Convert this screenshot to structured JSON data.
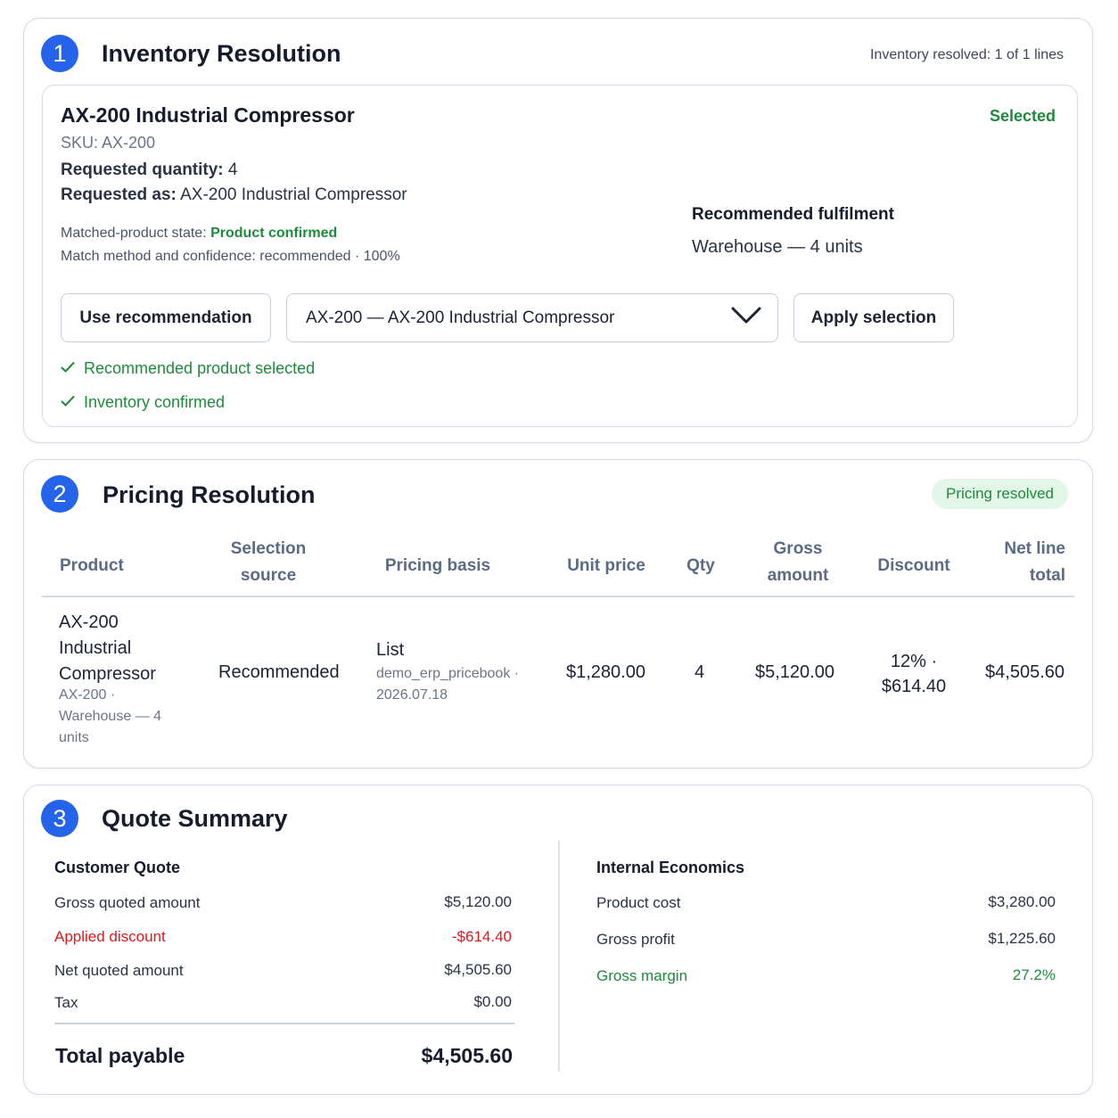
{
  "inventory": {
    "step": "1",
    "title": "Inventory Resolution",
    "status": "Inventory resolved: 1 of 1 lines",
    "product_name": "AX-200 Industrial Compressor",
    "selected_label": "Selected",
    "sku": "SKU: AX-200",
    "requested_quantity_label": "Requested quantity:",
    "requested_quantity_value": "4",
    "requested_as_label": "Requested as:",
    "requested_as_value": "AX-200 Industrial Compressor",
    "matched_state_label": "Matched-product state:",
    "matched_state_value": "Product confirmed",
    "match_method": "Match method and confidence: recommended · 100%",
    "fulfilment_title": "Recommended fulfilment",
    "fulfilment_value": "Warehouse — 4 units",
    "use_recommendation_label": "Use recommendation",
    "product_select_value": "AX-200 — AX-200 Industrial Compressor",
    "apply_selection_label": "Apply selection",
    "checks": [
      "Recommended product selected",
      "Inventory confirmed"
    ],
    "check_icon": "checkmark-icon"
  },
  "pricing": {
    "step": "2",
    "title": "Pricing Resolution",
    "status_pill": "Pricing resolved",
    "headers": {
      "product": "Product",
      "selection_source": "Selection\nsource",
      "pricing_basis": "Pricing basis",
      "unit_price": "Unit price",
      "qty": "Qty",
      "gross_amount": "Gross\namount",
      "discount": "Discount",
      "net_line_total": "Net line\ntotal"
    },
    "row": {
      "product_name": "AX-200\nIndustrial\nCompressor",
      "product_sub": "AX-200 ·\nWarehouse — 4\nunits",
      "selection_source": "Recommended",
      "pricing_basis": "List",
      "pricing_basis_sub": "demo_erp_pricebook ·\n2026.07.18",
      "unit_price": "$1,280.00",
      "qty": "4",
      "gross_amount": "$5,120.00",
      "discount": "12% ·\n$614.40",
      "net_line_total": "$4,505.60"
    }
  },
  "summary": {
    "step": "3",
    "title": "Quote Summary",
    "customer": {
      "heading": "Customer Quote",
      "gross_label": "Gross quoted amount",
      "gross_value": "$5,120.00",
      "discount_label": "Applied discount",
      "discount_value": "-$614.40",
      "net_label": "Net quoted amount",
      "net_value": "$4,505.60",
      "tax_label": "Tax",
      "tax_value": "$0.00",
      "total_label": "Total payable",
      "total_value": "$4,505.60"
    },
    "internal": {
      "heading": "Internal Economics",
      "cost_label": "Product cost",
      "cost_value": "$3,280.00",
      "profit_label": "Gross profit",
      "profit_value": "$1,225.60",
      "margin_label": "Gross margin",
      "margin_value": "27.2%"
    }
  },
  "colors": {
    "accent_blue": "#2563eb",
    "success_green": "#1e8a3c",
    "danger_red": "#e4161b",
    "pill_bg": "#e4f6e8"
  }
}
